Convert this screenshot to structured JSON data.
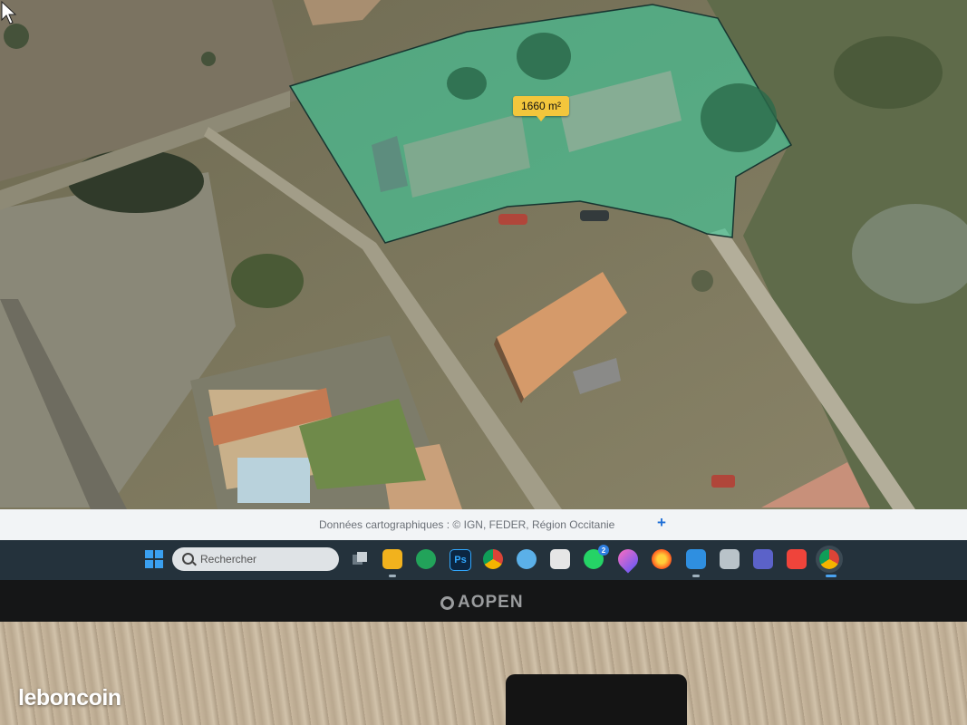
{
  "map": {
    "area_label": "1660 m²",
    "attribution": "Données cartographiques : ©    IGN,  FEDER,  Région Occitanie",
    "attribution_plus": "+",
    "parcel_color": "#40c99b"
  },
  "taskbar": {
    "search_placeholder": "Rechercher",
    "apps": [
      {
        "name": "task-view",
        "glyph": ""
      },
      {
        "name": "file-explorer",
        "glyph": ""
      },
      {
        "name": "edge",
        "glyph": ""
      },
      {
        "name": "photoshop",
        "glyph": "Ps"
      },
      {
        "name": "chrome",
        "glyph": ""
      },
      {
        "name": "paint",
        "glyph": ""
      },
      {
        "name": "snipping",
        "glyph": ""
      },
      {
        "name": "whatsapp",
        "glyph": "",
        "badge": "2"
      },
      {
        "name": "droplet",
        "glyph": ""
      },
      {
        "name": "firefox",
        "glyph": ""
      },
      {
        "name": "mail",
        "glyph": ""
      },
      {
        "name": "folder-doc",
        "glyph": ""
      },
      {
        "name": "notes",
        "glyph": ""
      },
      {
        "name": "teams",
        "glyph": ""
      },
      {
        "name": "anydesk",
        "glyph": ""
      },
      {
        "name": "chrome-active",
        "glyph": ""
      }
    ]
  },
  "monitor": {
    "brand": "AOPEN"
  },
  "watermark": "leboncoin"
}
